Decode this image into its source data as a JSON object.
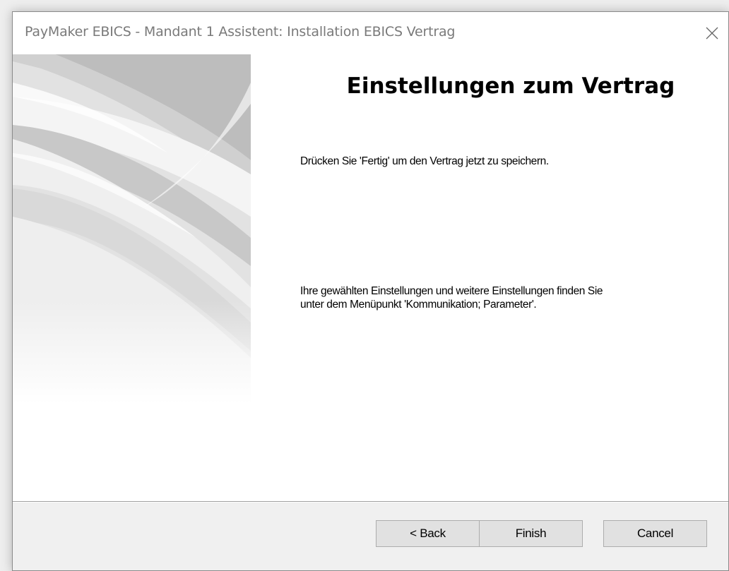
{
  "window": {
    "title": "PayMaker EBICS - Mandant 1 Assistent: Installation EBICS Vertrag"
  },
  "content": {
    "heading": "Einstellungen zum Vertrag",
    "paragraph1": "Drücken Sie 'Fertig' um den Vertrag jetzt zu speichern.",
    "paragraph2": "Ihre gewählten Einstellungen und weitere Einstellungen finden Sie unter dem Menüpunkt 'Kommunikation; Parameter'."
  },
  "buttons": {
    "back": "< Back",
    "finish": "Finish",
    "cancel": "Cancel"
  },
  "icons": {
    "close": "close-icon",
    "side_image": "wizard-banner-image"
  },
  "colors": {
    "window_bg": "#f0f0f0",
    "panel_bg": "#ffffff",
    "button_bg": "#e1e1e1",
    "title_text": "#7a7a7a"
  }
}
